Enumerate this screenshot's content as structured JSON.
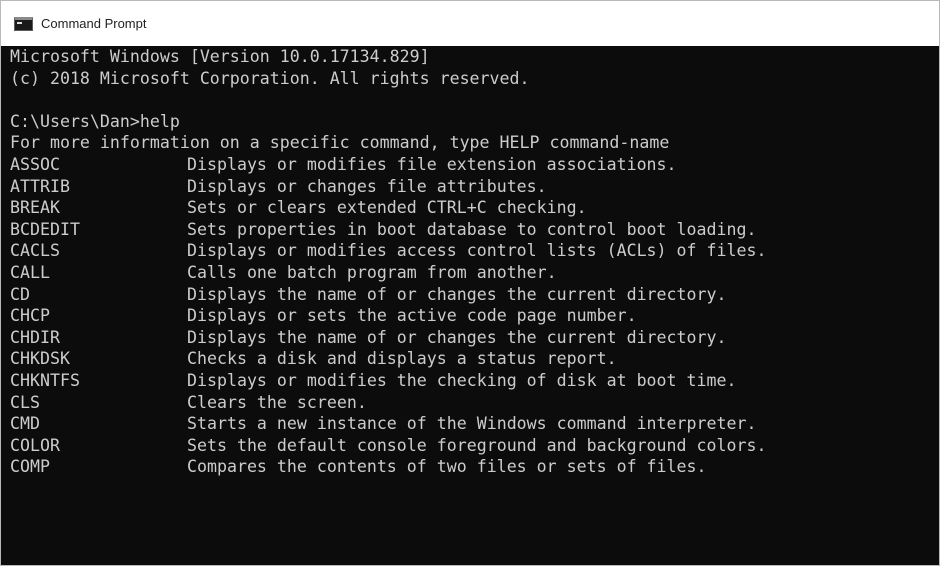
{
  "window": {
    "title": "Command Prompt"
  },
  "colors": {
    "console_bg": "#0c0c0c",
    "console_fg": "#cccccc",
    "titlebar_bg": "#ffffff"
  },
  "console": {
    "header_lines": [
      "Microsoft Windows [Version 10.0.17134.829]",
      "(c) 2018 Microsoft Corporation. All rights reserved.",
      ""
    ],
    "prompt": "C:\\Users\\Dan>help",
    "info_line": "For more information on a specific command, type HELP command-name",
    "commands": [
      {
        "name": "ASSOC",
        "desc": "Displays or modifies file extension associations."
      },
      {
        "name": "ATTRIB",
        "desc": "Displays or changes file attributes."
      },
      {
        "name": "BREAK",
        "desc": "Sets or clears extended CTRL+C checking."
      },
      {
        "name": "BCDEDIT",
        "desc": "Sets properties in boot database to control boot loading."
      },
      {
        "name": "CACLS",
        "desc": "Displays or modifies access control lists (ACLs) of files."
      },
      {
        "name": "CALL",
        "desc": "Calls one batch program from another."
      },
      {
        "name": "CD",
        "desc": "Displays the name of or changes the current directory."
      },
      {
        "name": "CHCP",
        "desc": "Displays or sets the active code page number."
      },
      {
        "name": "CHDIR",
        "desc": "Displays the name of or changes the current directory."
      },
      {
        "name": "CHKDSK",
        "desc": "Checks a disk and displays a status report."
      },
      {
        "name": "CHKNTFS",
        "desc": "Displays or modifies the checking of disk at boot time."
      },
      {
        "name": "CLS",
        "desc": "Clears the screen."
      },
      {
        "name": "CMD",
        "desc": "Starts a new instance of the Windows command interpreter."
      },
      {
        "name": "COLOR",
        "desc": "Sets the default console foreground and background colors."
      },
      {
        "name": "COMP",
        "desc": "Compares the contents of two files or sets of files."
      }
    ]
  }
}
